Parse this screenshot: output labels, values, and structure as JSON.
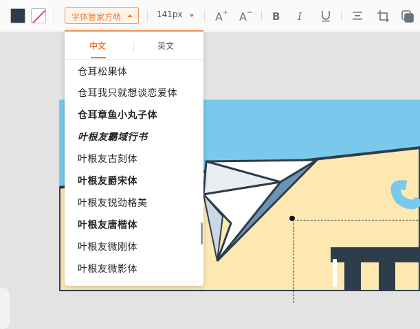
{
  "toolbar": {
    "font_family": "字体管家方萌",
    "font_size": "141px",
    "tools": [
      "increase-font-icon",
      "decrease-font-icon",
      "bold-icon",
      "italic-icon",
      "underline-icon",
      "align-icon",
      "line-height-icon",
      "layer-icon"
    ]
  },
  "colors": {
    "fill": "#2f3c4a",
    "accent": "#f07b2e",
    "canvas_bg": "#79c9ec"
  },
  "font_panel": {
    "tabs": [
      "中文",
      "英文"
    ],
    "active_tab": "中文",
    "fonts": [
      "仓耳松果体",
      "仓耳我只就想谈恋爱体",
      "仓耳章鱼小丸子体",
      "叶根友霸域行书",
      "叶根友古刻体",
      "叶根友爵宋体",
      "叶根友锐劲格美",
      "叶根友唐楷体",
      "叶根友微刚体",
      "叶根友微影体"
    ]
  }
}
